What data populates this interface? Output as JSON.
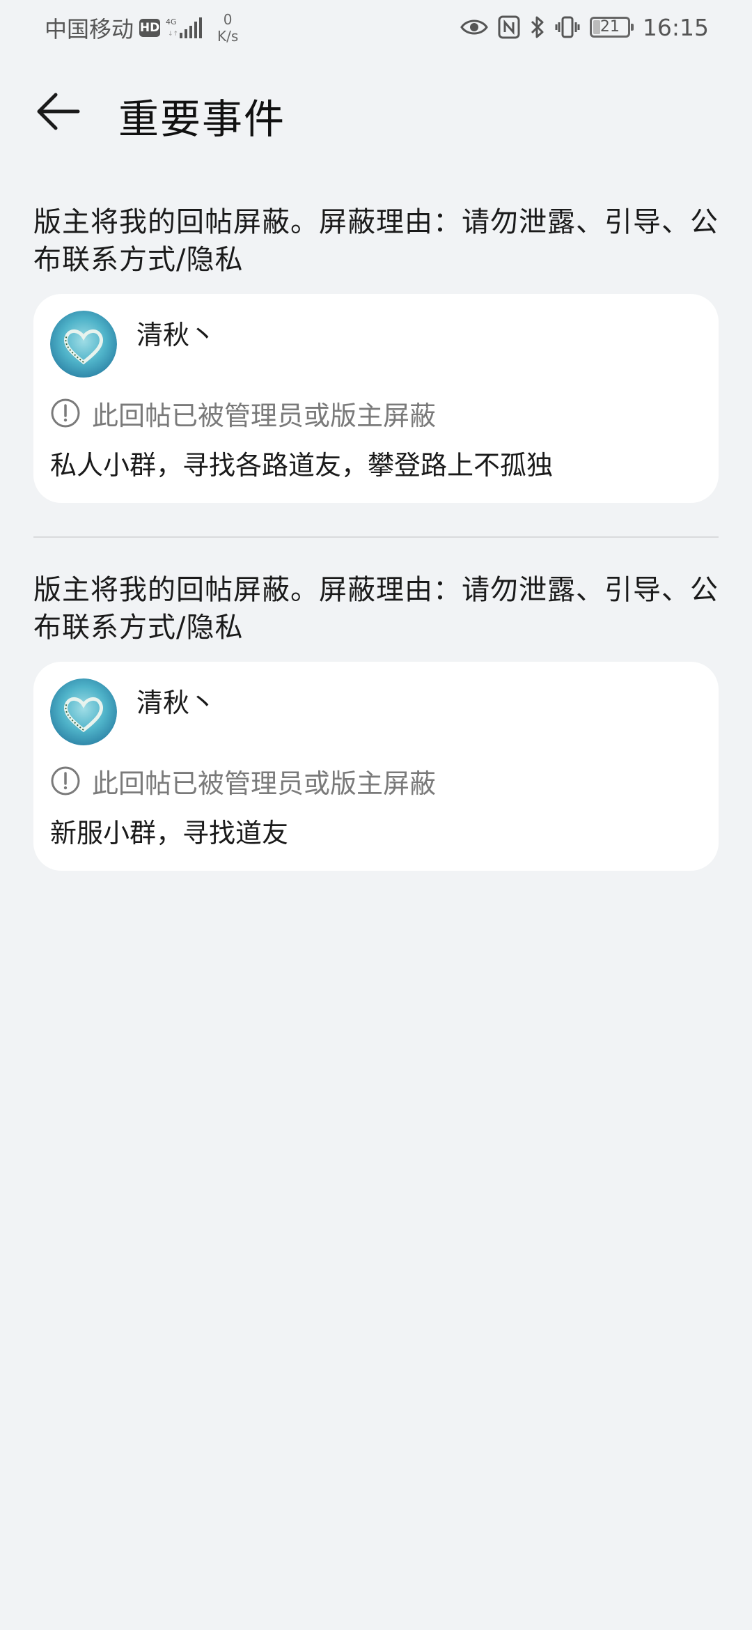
{
  "status_bar": {
    "carrier": "中国移动",
    "hd": "HD",
    "network": "4G",
    "speed_value": "0",
    "speed_unit": "K/s",
    "battery": "21",
    "time": "16:15"
  },
  "header": {
    "title": "重要事件"
  },
  "events": [
    {
      "description": "版主将我的回帖屏蔽。屏蔽理由：请勿泄露、引导、公布联系方式/隐私",
      "username": "清秋丶",
      "notice": "此回帖已被管理员或版主屏蔽",
      "reply": "私人小群，寻找各路道友，攀登路上不孤独"
    },
    {
      "description": "版主将我的回帖屏蔽。屏蔽理由：请勿泄露、引导、公布联系方式/隐私",
      "username": "清秋丶",
      "notice": "此回帖已被管理员或版主屏蔽",
      "reply": "新服小群，寻找道友"
    }
  ],
  "colors": {
    "background": "#f1f3f5",
    "card": "#ffffff",
    "muted_text": "#7a7a7a"
  }
}
